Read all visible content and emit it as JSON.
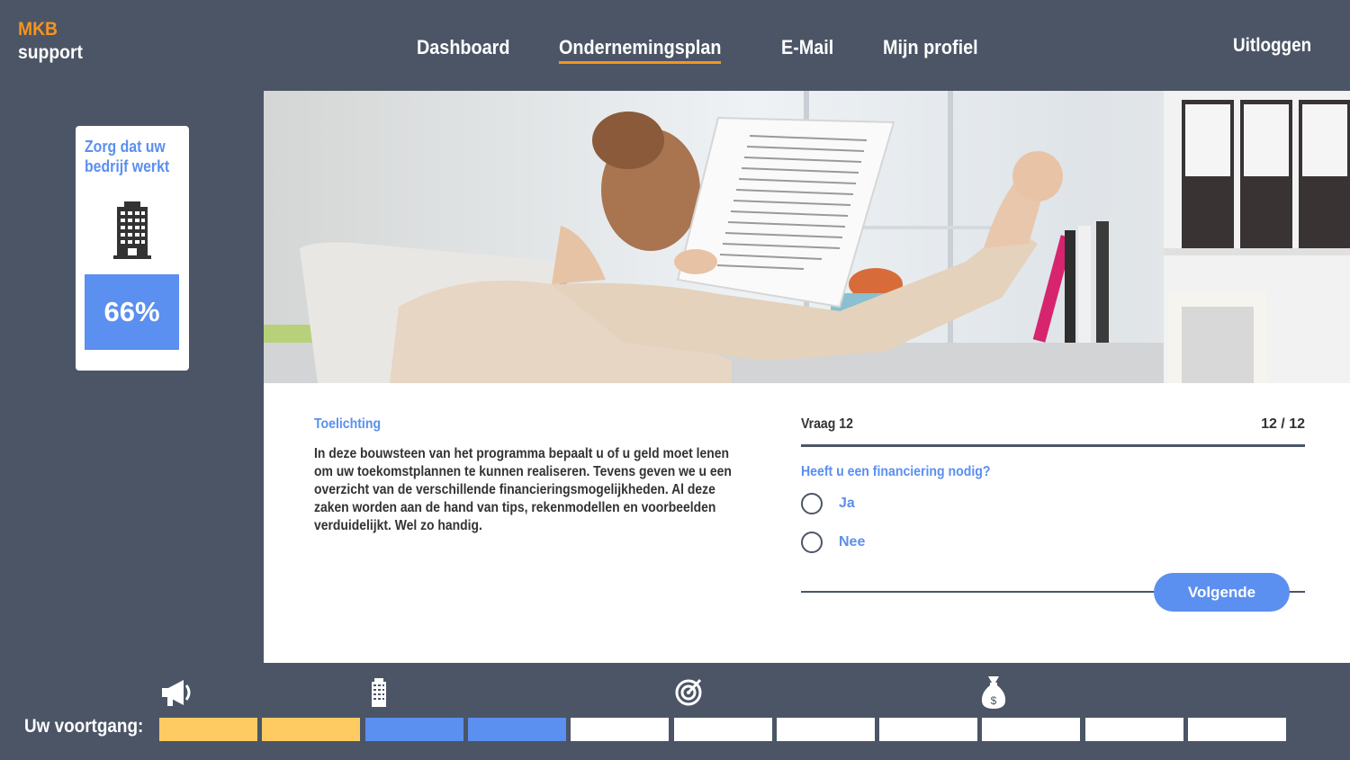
{
  "brand": {
    "line1": "MKB",
    "line2": "support"
  },
  "nav": {
    "items": [
      {
        "label": "Dashboard",
        "active": false
      },
      {
        "label": "Ondernemingsplan",
        "active": true
      },
      {
        "label": "E-Mail",
        "active": false
      },
      {
        "label": "Mijn profiel",
        "active": false
      }
    ],
    "logout": "Uitloggen"
  },
  "colors": {
    "accent": "#5b8ff0",
    "brand_orange": "#f7941d",
    "background": "#4b5566",
    "done": "#fecb63",
    "current": "#5b8ff0",
    "todo": "#ffffff"
  },
  "card": {
    "title": "Zorg dat uw bedrijf werkt",
    "icon": "building-icon",
    "percent": "66%"
  },
  "explanation": {
    "heading": "Toelichting",
    "text": "In deze bouwsteen van het programma bepaalt u of u geld moet lenen om uw toekomstplannen te kunnen realiseren. Tevens geven we u een overzicht van de verschillende financieringsmogelijkheden. Al deze zaken worden aan de hand van tips, rekenmodellen en voorbeelden verduidelijkt. Wel zo handig."
  },
  "question": {
    "label": "Vraag 12",
    "count": "12 / 12",
    "text": "Heeft u een financiering nodig?",
    "options": [
      "Ja",
      "Nee"
    ],
    "next_label": "Volgende"
  },
  "progress": {
    "label": "Uw voortgang:",
    "icons": [
      "megaphone-icon",
      "building-icon",
      "target-icon",
      "money-bag-icon"
    ],
    "segments": [
      "done",
      "done",
      "current",
      "current",
      "todo",
      "todo",
      "todo",
      "todo",
      "todo",
      "todo",
      "todo"
    ]
  }
}
